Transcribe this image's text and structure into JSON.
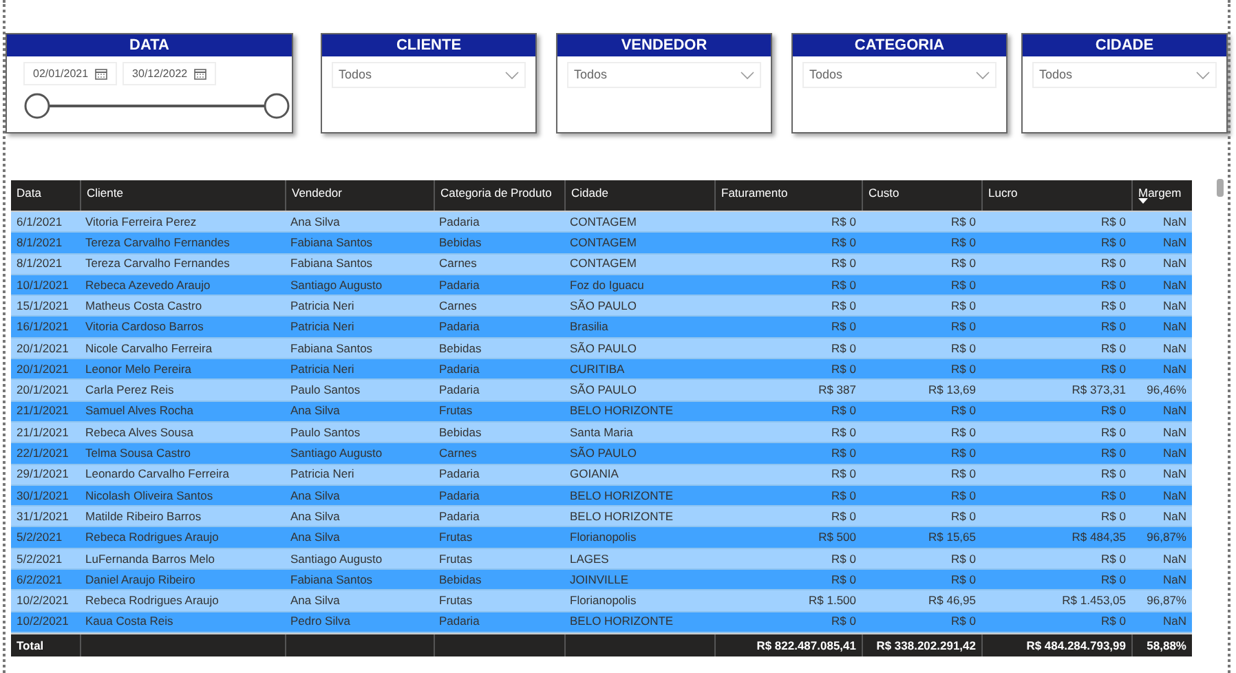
{
  "filters": [
    {
      "title": "DATA",
      "kind": "date_range",
      "start": "02/01/2021",
      "end": "30/12/2022",
      "handles": [
        {
          "level": 0
        },
        {
          "level": 1
        }
      ]
    },
    {
      "title": "CLIENTE",
      "kind": "dropdown",
      "value": "Todos"
    },
    {
      "title": "VENDEDOR",
      "kind": "dropdown",
      "value": "Todos"
    },
    {
      "title": "CATEGORIA",
      "kind": "dropdown",
      "value": "Todos"
    },
    {
      "title": "CIDADE",
      "kind": "dropdown",
      "value": "Todos"
    }
  ],
  "table": {
    "columns": [
      {
        "label": "Data",
        "sorted": false
      },
      {
        "label": "Cliente",
        "sorted": false
      },
      {
        "label": "Vendedor",
        "sorted": false
      },
      {
        "label": "Categoria de Produto",
        "sorted": false
      },
      {
        "label": "Cidade",
        "sorted": false
      },
      {
        "label": "Faturamento",
        "sorted": false
      },
      {
        "label": "Custo",
        "sorted": false
      },
      {
        "label": "Lucro",
        "sorted": false
      },
      {
        "label": "Margem",
        "sorted": true
      }
    ],
    "rows": [
      [
        "6/1/2021",
        "Vitoria Ferreira Perez",
        "Ana Silva",
        "Padaria",
        "CONTAGEM",
        "R$ 0",
        "R$ 0",
        "R$ 0",
        "NaN"
      ],
      [
        "8/1/2021",
        "Tereza Carvalho Fernandes",
        "Fabiana Santos",
        "Bebidas",
        "CONTAGEM",
        "R$ 0",
        "R$ 0",
        "R$ 0",
        "NaN"
      ],
      [
        "8/1/2021",
        "Tereza Carvalho Fernandes",
        "Fabiana Santos",
        "Carnes",
        "CONTAGEM",
        "R$ 0",
        "R$ 0",
        "R$ 0",
        "NaN"
      ],
      [
        "10/1/2021",
        "Rebeca Azevedo Araujo",
        "Santiago Augusto",
        "Padaria",
        "Foz do Iguacu",
        "R$ 0",
        "R$ 0",
        "R$ 0",
        "NaN"
      ],
      [
        "15/1/2021",
        "Matheus Costa Castro",
        "Patricia Neri",
        "Carnes",
        "SÃO PAULO",
        "R$ 0",
        "R$ 0",
        "R$ 0",
        "NaN"
      ],
      [
        "16/1/2021",
        "Vitoria Cardoso Barros",
        "Patricia Neri",
        "Padaria",
        "Brasilia",
        "R$ 0",
        "R$ 0",
        "R$ 0",
        "NaN"
      ],
      [
        "20/1/2021",
        "Nicole Carvalho Ferreira",
        "Fabiana Santos",
        "Bebidas",
        "SÃO PAULO",
        "R$ 0",
        "R$ 0",
        "R$ 0",
        "NaN"
      ],
      [
        "20/1/2021",
        "Leonor Melo Pereira",
        "Patricia Neri",
        "Padaria",
        "CURITIBA",
        "R$ 0",
        "R$ 0",
        "R$ 0",
        "NaN"
      ],
      [
        "20/1/2021",
        "Carla Perez Reis",
        "Paulo Santos",
        "Padaria",
        "SÃO PAULO",
        "R$ 387",
        "R$ 13,69",
        "R$ 373,31",
        "96,46%"
      ],
      [
        "21/1/2021",
        "Samuel Alves Rocha",
        "Ana Silva",
        "Frutas",
        "BELO HORIZONTE",
        "R$ 0",
        "R$ 0",
        "R$ 0",
        "NaN"
      ],
      [
        "21/1/2021",
        "Rebeca Alves Sousa",
        "Paulo Santos",
        "Bebidas",
        "Santa Maria",
        "R$ 0",
        "R$ 0",
        "R$ 0",
        "NaN"
      ],
      [
        "22/1/2021",
        "Telma Sousa Castro",
        "Santiago Augusto",
        "Carnes",
        "SÃO PAULO",
        "R$ 0",
        "R$ 0",
        "R$ 0",
        "NaN"
      ],
      [
        "29/1/2021",
        "Leonardo Carvalho Ferreira",
        "Patricia Neri",
        "Padaria",
        "GOIANIA",
        "R$ 0",
        "R$ 0",
        "R$ 0",
        "NaN"
      ],
      [
        "30/1/2021",
        "Nicolash Oliveira Santos",
        "Ana Silva",
        "Padaria",
        "BELO HORIZONTE",
        "R$ 0",
        "R$ 0",
        "R$ 0",
        "NaN"
      ],
      [
        "31/1/2021",
        "Matilde Ribeiro Barros",
        "Ana Silva",
        "Padaria",
        "BELO HORIZONTE",
        "R$ 0",
        "R$ 0",
        "R$ 0",
        "NaN"
      ],
      [
        "5/2/2021",
        "Rebeca Rodrigues Araujo",
        "Ana Silva",
        "Frutas",
        "Florianopolis",
        "R$ 500",
        "R$ 15,65",
        "R$ 484,35",
        "96,87%"
      ],
      [
        "5/2/2021",
        "LuFernanda Barros Melo",
        "Santiago Augusto",
        "Frutas",
        "LAGES",
        "R$ 0",
        "R$ 0",
        "R$ 0",
        "NaN"
      ],
      [
        "6/2/2021",
        "Daniel Araujo Ribeiro",
        "Fabiana Santos",
        "Bebidas",
        "JOINVILLE",
        "R$ 0",
        "R$ 0",
        "R$ 0",
        "NaN"
      ],
      [
        "10/2/2021",
        "Rebeca Rodrigues Araujo",
        "Ana Silva",
        "Frutas",
        "Florianopolis",
        "R$ 1.500",
        "R$ 46,95",
        "R$ 1.453,05",
        "96,87%"
      ],
      [
        "10/2/2021",
        "Kaua Costa Reis",
        "Pedro Silva",
        "Padaria",
        "BELO HORIZONTE",
        "R$ 0",
        "R$ 0",
        "R$ 0",
        "NaN"
      ]
    ],
    "total": {
      "label": "Total",
      "values": [
        "R$ 822.487.085,41",
        "R$ 338.202.291,42",
        "R$ 484.284.793,99",
        "58,88%"
      ]
    }
  }
}
